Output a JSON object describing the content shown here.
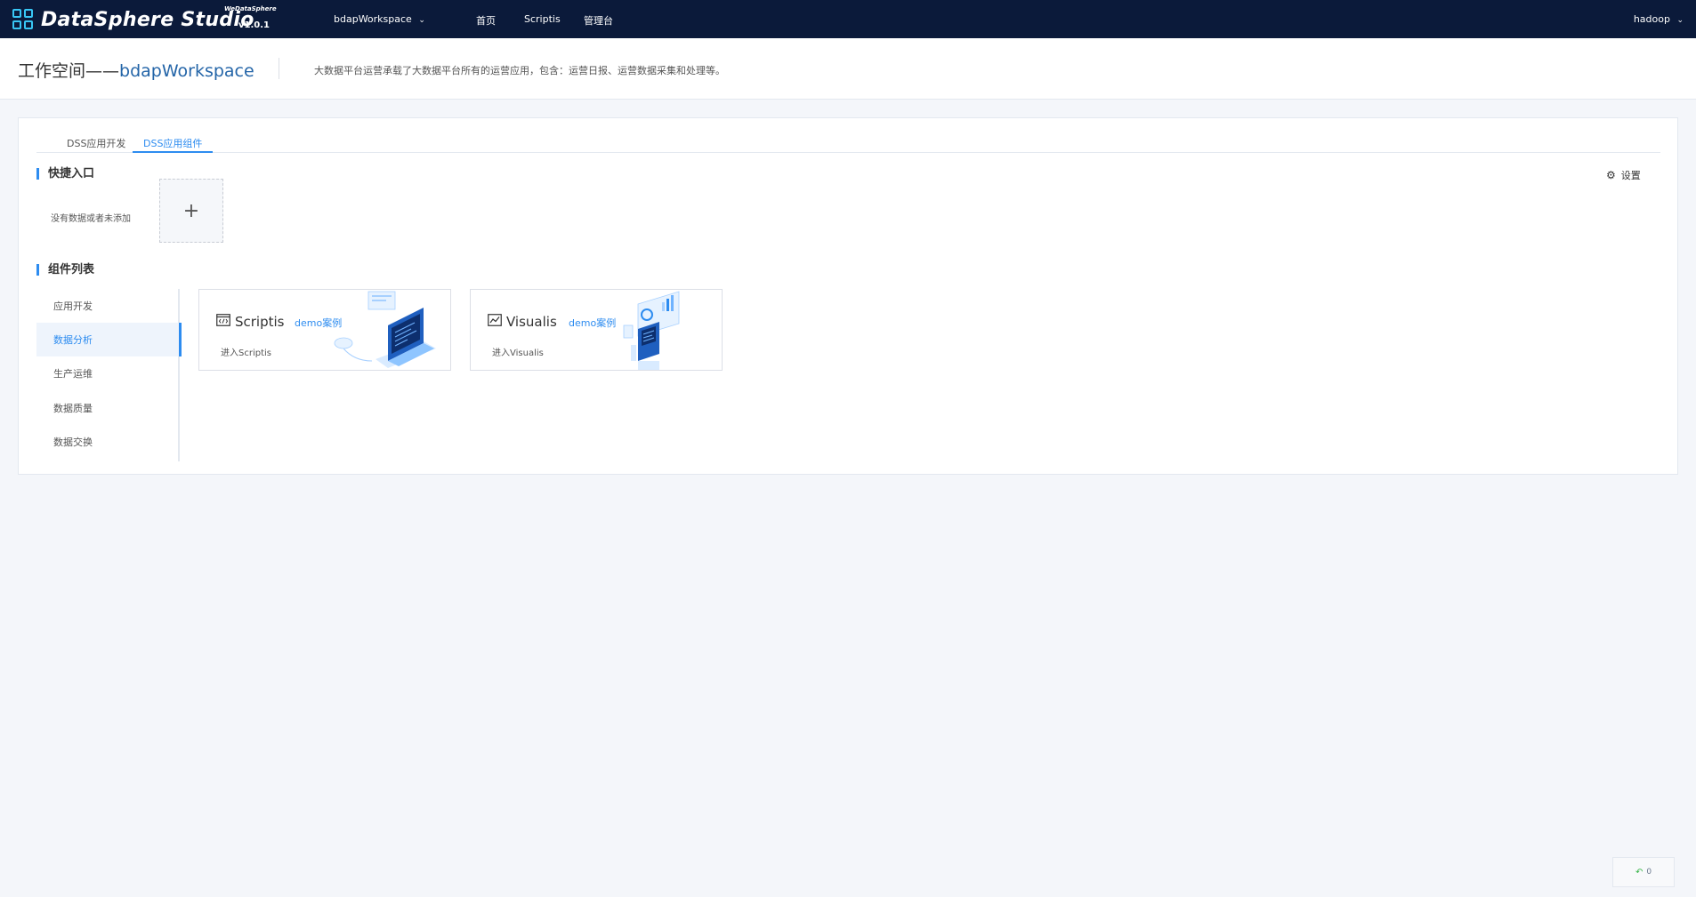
{
  "header": {
    "brand": "DataSphere Studio",
    "brand_sub": "WeDataSphere",
    "version": "v1.0.1",
    "workspace_select": "bdapWorkspace",
    "nav": [
      "首页",
      "Scriptis",
      "管理台"
    ],
    "user": "hadoop"
  },
  "title_bar": {
    "prefix": "工作空间——",
    "workspace_name": "bdapWorkspace",
    "description": "大数据平台运营承载了大数据平台所有的运营应用，包含：运营日报、运营数据采集和处理等。"
  },
  "tabs": [
    {
      "label": "DSS应用开发",
      "active": false
    },
    {
      "label": "DSS应用组件",
      "active": true
    }
  ],
  "quick_entry": {
    "title": "快捷入口",
    "empty_text": "没有数据或者未添加",
    "add_symbol": "+",
    "settings_label": "设置"
  },
  "component_list": {
    "title": "组件列表",
    "categories": [
      {
        "label": "应用开发",
        "active": false
      },
      {
        "label": "数据分析",
        "active": true
      },
      {
        "label": "生产运维",
        "active": false
      },
      {
        "label": "数据质量",
        "active": false
      },
      {
        "label": "数据交换",
        "active": false
      }
    ],
    "cards": [
      {
        "name": "Scriptis",
        "demo_label": "demo案例",
        "enter_label": "进入Scriptis",
        "icon": "code-window-icon"
      },
      {
        "name": "Visualis",
        "demo_label": "demo案例",
        "enter_label": "进入Visualis",
        "icon": "chart-icon"
      }
    ]
  },
  "bottom_widget": {
    "value": "0"
  },
  "colors": {
    "topbar": "#0b1a3a",
    "accent": "#2d8cf0",
    "title_blue": "#2465a8",
    "logo_cyan": "#38c7f5"
  }
}
